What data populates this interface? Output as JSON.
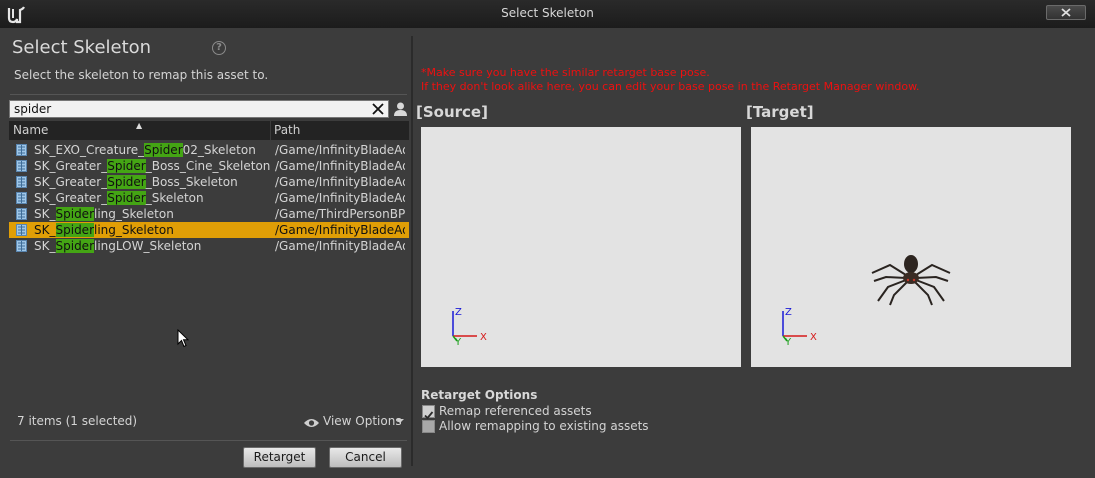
{
  "window": {
    "title": "Select Skeleton"
  },
  "left_panel": {
    "heading": "Select Skeleton",
    "subtitle": "Select the skeleton to remap this asset to.",
    "search": {
      "value": "spider"
    },
    "columns": {
      "name": "Name",
      "path": "Path"
    },
    "rows": [
      {
        "pre": "SK_EXO_Creature_",
        "match": "Spider",
        "post": "02_Skeleton",
        "path": "/Game/InfinityBladeAdv"
      },
      {
        "pre": "SK_Greater_",
        "match": "Spider",
        "post": "_Boss_Cine_Skeleton",
        "path": "/Game/InfinityBladeAdv"
      },
      {
        "pre": "SK_Greater_",
        "match": "Spider",
        "post": "_Boss_Skeleton",
        "path": "/Game/InfinityBladeAdv"
      },
      {
        "pre": "SK_Greater_",
        "match": "Spider",
        "post": "_Skeleton",
        "path": "/Game/InfinityBladeAdv"
      },
      {
        "pre": "SK_",
        "match": "Spider",
        "post": "ling_Skeleton",
        "path": "/Game/ThirdPersonBP/"
      },
      {
        "pre": "SK_",
        "match": "Spider",
        "post": "ling_Skeleton",
        "path": "/Game/InfinityBladeAdv",
        "selected": true
      },
      {
        "pre": "SK_",
        "match": "Spider",
        "post": "lingLOW_Skeleton",
        "path": "/Game/InfinityBladeAdv"
      }
    ],
    "item_count": "7 items (1 selected)",
    "view_options": "View Options",
    "buttons": {
      "retarget": "Retarget",
      "cancel": "Cancel"
    }
  },
  "right_panel": {
    "warning_line1": "*Make sure you have the similar retarget base pose.",
    "warning_line2": "If they don't look alike here, you can edit your base pose in the Retarget Manager window.",
    "source_label": "[Source]",
    "target_label": "[Target]",
    "axis": {
      "x": "X",
      "y": "Y",
      "z": "Z"
    },
    "retarget_options": {
      "title": "Retarget Options",
      "remap_referenced": {
        "label": "Remap referenced assets",
        "checked": true
      },
      "allow_remapping": {
        "label": "Allow remapping to existing assets",
        "checked": false
      }
    }
  },
  "colors": {
    "selection": "#e09e06",
    "match_highlight": "#44a514",
    "warning": "#ee1010"
  }
}
